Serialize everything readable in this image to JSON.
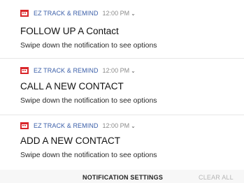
{
  "colors": {
    "app_name": "#3a5ea8",
    "icon_red": "#d9262a",
    "footer_bg": "#f7f7f7",
    "clear_all_disabled": "#b5b5b5"
  },
  "notifications": [
    {
      "icon": "calendar-icon",
      "app_name": "EZ TRACK & REMIND",
      "time": "12:00 PM",
      "title": "FOLLOW UP A Contact",
      "body": "Swipe down the notification to see options"
    },
    {
      "icon": "calendar-icon",
      "app_name": "EZ TRACK & REMIND",
      "time": "12:00 PM",
      "title": "CALL A NEW CONTACT",
      "body": "Swipe down the notification to see options"
    },
    {
      "icon": "calendar-icon",
      "app_name": "EZ TRACK & REMIND",
      "time": "12:00 PM",
      "title": "ADD A NEW CONTACT",
      "body": "Swipe down the notification to see options"
    }
  ],
  "footer": {
    "settings_label": "NOTIFICATION SETTINGS",
    "clear_label": "CLEAR ALL"
  }
}
